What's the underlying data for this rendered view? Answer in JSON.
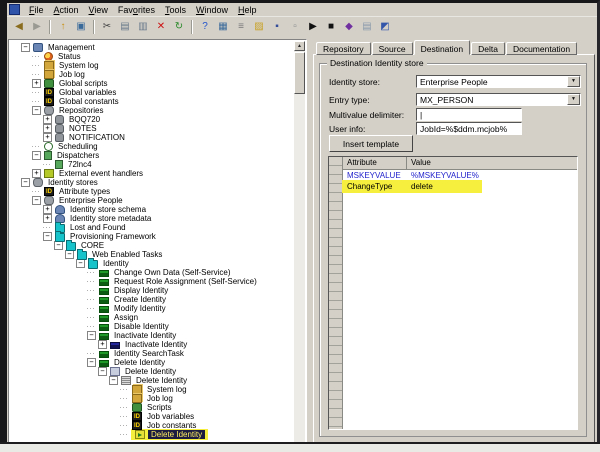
{
  "colors": {
    "chrome": "#d4d0c8",
    "marker_yellow": "#f6ef3d",
    "selection_bg": "#1c1c40",
    "selection_text": "#ffef60",
    "attribute_link_blue": "#2121cc",
    "folder_cyan": "#17c3cb",
    "task_green": "#1f9a28"
  },
  "window": {
    "menu": [
      {
        "label": "File",
        "u": 0
      },
      {
        "label": "Action",
        "u": 0
      },
      {
        "label": "View",
        "u": 0
      },
      {
        "label": "Favorites",
        "u": 3
      },
      {
        "label": "Tools",
        "u": 0
      },
      {
        "label": "Window",
        "u": 0
      },
      {
        "label": "Help",
        "u": 0
      }
    ],
    "toolbar": [
      {
        "name": "back",
        "glyph": "◀",
        "color": "#8a6d1f"
      },
      {
        "name": "forward",
        "glyph": "▶",
        "color": "#9a9a92"
      },
      {
        "sep": true
      },
      {
        "name": "up-one-level",
        "glyph": "↑",
        "color": "#c89010"
      },
      {
        "name": "show-properties",
        "glyph": "▣",
        "color": "#3a6a9a"
      },
      {
        "sep": true
      },
      {
        "name": "cut",
        "glyph": "✂",
        "color": "#444444"
      },
      {
        "name": "copy",
        "glyph": "▤",
        "color": "#667788"
      },
      {
        "name": "paste",
        "glyph": "▥",
        "color": "#667788"
      },
      {
        "name": "delete",
        "glyph": "✕",
        "color": "#cc1111"
      },
      {
        "name": "refresh",
        "glyph": "↻",
        "color": "#2a8a2a"
      },
      {
        "sep": true
      },
      {
        "name": "help",
        "glyph": "?",
        "color": "#2255cc"
      },
      {
        "name": "show-window",
        "glyph": "▦",
        "color": "#3a6a9a"
      },
      {
        "name": "console-tree",
        "glyph": "≡",
        "color": "#777777"
      },
      {
        "name": "open-folder",
        "glyph": "▨",
        "color": "#c8a020"
      },
      {
        "name": "save",
        "glyph": "▪",
        "color": "#334d99"
      },
      {
        "name": "new-document",
        "glyph": "▫",
        "color": "#888888"
      },
      {
        "name": "run",
        "glyph": "▶",
        "color": "#111111"
      },
      {
        "name": "stop",
        "glyph": "■",
        "color": "#111111"
      },
      {
        "name": "book",
        "glyph": "◆",
        "color": "#7030a0"
      },
      {
        "name": "notes",
        "glyph": "▤",
        "color": "#8899aa"
      },
      {
        "name": "export",
        "glyph": "◩",
        "color": "#3355aa"
      }
    ]
  },
  "tree": {
    "items": [
      {
        "d": 1,
        "x": "-",
        "i": "management",
        "t": "Management"
      },
      {
        "d": 2,
        "x": null,
        "i": "status",
        "t": "Status"
      },
      {
        "d": 2,
        "x": null,
        "i": "log",
        "t": "System log"
      },
      {
        "d": 2,
        "x": null,
        "i": "log",
        "t": "Job log"
      },
      {
        "d": 2,
        "x": "+",
        "i": "scripts",
        "t": "Global scripts"
      },
      {
        "d": 2,
        "x": null,
        "i": "vars",
        "t": "Global variables"
      },
      {
        "d": 2,
        "x": null,
        "i": "vars",
        "t": "Global constants"
      },
      {
        "d": 2,
        "x": "-",
        "i": "repos",
        "t": "Repositories"
      },
      {
        "d": 3,
        "x": "+",
        "i": "db",
        "t": "BQQ720"
      },
      {
        "d": 3,
        "x": "+",
        "i": "db",
        "t": "NOTES"
      },
      {
        "d": 3,
        "x": "+",
        "i": "db",
        "t": "NOTIFICATION"
      },
      {
        "d": 2,
        "x": null,
        "i": "clock",
        "t": "Scheduling"
      },
      {
        "d": 2,
        "x": "-",
        "i": "dispatcher",
        "t": "Dispatchers"
      },
      {
        "d": 3,
        "x": null,
        "i": "dispatcher",
        "t": "72lnc4"
      },
      {
        "d": 2,
        "x": "+",
        "i": "event",
        "t": "External event handlers"
      },
      {
        "d": 1,
        "x": "-",
        "i": "stores",
        "t": "Identity stores"
      },
      {
        "d": 2,
        "x": null,
        "i": "vars",
        "t": "Attribute types"
      },
      {
        "d": 2,
        "x": "-",
        "i": "stores",
        "t": "Enterprise People"
      },
      {
        "d": 3,
        "x": "+",
        "i": "schema",
        "t": "Identity store schema"
      },
      {
        "d": 3,
        "x": "+",
        "i": "schema",
        "t": "Identity store metadata"
      },
      {
        "d": 3,
        "x": null,
        "i": "folder",
        "t": "Lost and Found"
      },
      {
        "d": 3,
        "x": "-",
        "i": "folder",
        "t": "Provisioning Framework"
      },
      {
        "d": 4,
        "x": "-",
        "i": "folder",
        "t": "CORE"
      },
      {
        "d": 5,
        "x": "-",
        "i": "folder",
        "t": "Web Enabled Tasks"
      },
      {
        "d": 6,
        "x": "-",
        "i": "folder",
        "t": "Identity"
      },
      {
        "d": 7,
        "x": null,
        "i": "task",
        "t": "Change Own Data (Self-Service)"
      },
      {
        "d": 7,
        "x": null,
        "i": "task",
        "t": "Request Role Assignment (Self-Service)"
      },
      {
        "d": 7,
        "x": null,
        "i": "task",
        "t": "Display Identity"
      },
      {
        "d": 7,
        "x": null,
        "i": "task",
        "t": "Create Identity"
      },
      {
        "d": 7,
        "x": null,
        "i": "task",
        "t": "Modify Identity"
      },
      {
        "d": 7,
        "x": null,
        "i": "task",
        "t": "Assign"
      },
      {
        "d": 7,
        "x": null,
        "i": "task",
        "t": "Disable Identity"
      },
      {
        "d": 7,
        "x": "-",
        "i": "task",
        "t": "Inactivate Identity"
      },
      {
        "d": 8,
        "x": "+",
        "i": "task2",
        "t": "Inactivate Identity"
      },
      {
        "d": 7,
        "x": null,
        "i": "task",
        "t": "Identity SearchTask"
      },
      {
        "d": 7,
        "x": "-",
        "i": "task",
        "t": "Delete Identity"
      },
      {
        "d": 8,
        "x": "-",
        "i": "ordered",
        "t": "Delete Identity"
      },
      {
        "d": 9,
        "x": "-",
        "i": "job",
        "t": "Delete Identity"
      },
      {
        "d": 10,
        "x": null,
        "i": "log",
        "t": "System log"
      },
      {
        "d": 10,
        "x": null,
        "i": "log",
        "t": "Job log"
      },
      {
        "d": 10,
        "x": null,
        "i": "scripts",
        "t": "Scripts"
      },
      {
        "d": 10,
        "x": null,
        "i": "vars",
        "t": "Job variables"
      },
      {
        "d": 10,
        "x": null,
        "i": "vars",
        "t": "Job constants"
      },
      {
        "d": 10,
        "x": null,
        "i": "action",
        "t": "Delete Identity",
        "sel": true
      }
    ]
  },
  "panel": {
    "tabs": [
      "Repository",
      "Source",
      "Destination",
      "Delta",
      "Documentation"
    ],
    "active_tab": "Destination",
    "active_tab_index": 2,
    "group_title": "Destination Identity store",
    "fields": [
      {
        "label": "Identity store:",
        "value": "Enterprise People",
        "type": "combo"
      },
      {
        "label": "Entry type:",
        "value": "MX_PERSON",
        "type": "combo"
      },
      {
        "label": "Multivalue delimiter:",
        "value": "|",
        "type": "text"
      },
      {
        "label": "User info:",
        "value": "JobId=%$ddm.mcjob%",
        "type": "text"
      }
    ],
    "insert_template_label": "Insert template",
    "table": {
      "headers": [
        "Attribute",
        "Value"
      ],
      "rows": [
        {
          "attribute": "MSKEYVALUE",
          "value": "%MSKEYVALUE%",
          "blue": true,
          "highlight": false
        },
        {
          "attribute": "ChangeType",
          "value": "delete",
          "blue": false,
          "highlight": true
        }
      ]
    }
  }
}
